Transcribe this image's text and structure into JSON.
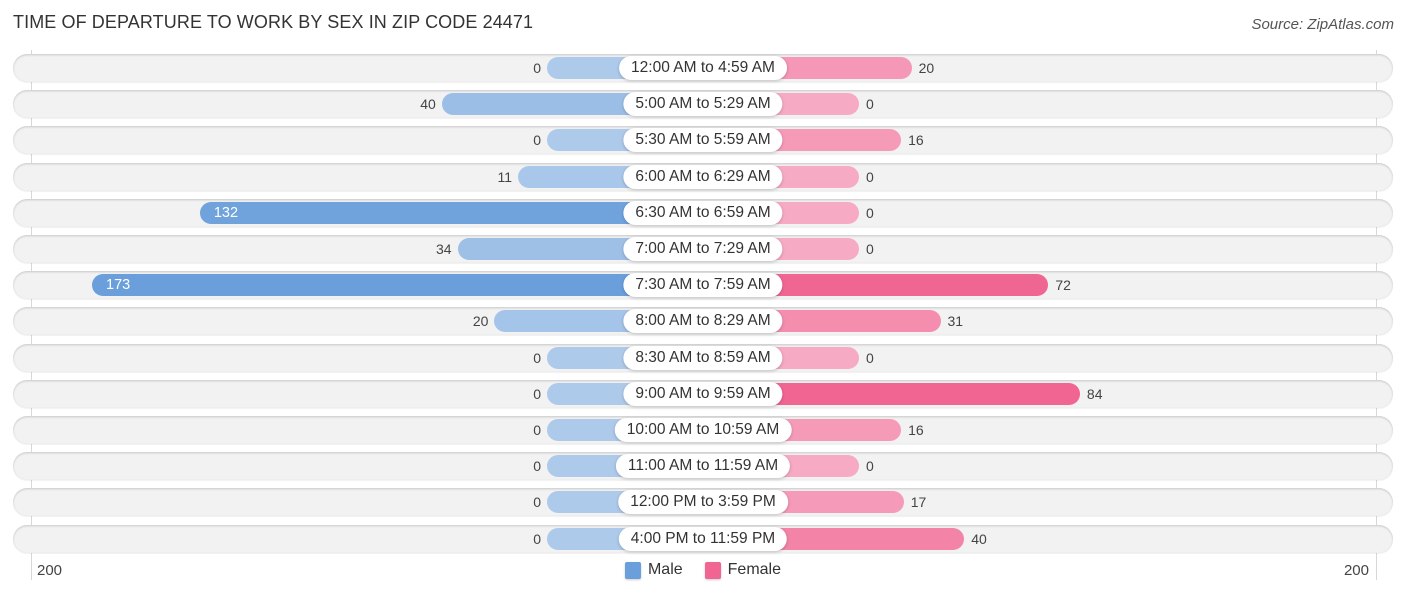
{
  "chart_data": {
    "type": "bar",
    "orientation": "horizontal-diverging",
    "title": "TIME OF DEPARTURE TO WORK BY SEX IN ZIP CODE 24471",
    "source": "Source: ZipAtlas.com",
    "categories": [
      "12:00 AM to 4:59 AM",
      "5:00 AM to 5:29 AM",
      "5:30 AM to 5:59 AM",
      "6:00 AM to 6:29 AM",
      "6:30 AM to 6:59 AM",
      "7:00 AM to 7:29 AM",
      "7:30 AM to 7:59 AM",
      "8:00 AM to 8:29 AM",
      "8:30 AM to 8:59 AM",
      "9:00 AM to 9:59 AM",
      "10:00 AM to 10:59 AM",
      "11:00 AM to 11:59 AM",
      "12:00 PM to 3:59 PM",
      "4:00 PM to 11:59 PM"
    ],
    "series": [
      {
        "name": "Male",
        "color": "#6a9fdb",
        "values": [
          0,
          40,
          0,
          11,
          132,
          34,
          173,
          20,
          0,
          0,
          0,
          0,
          0,
          0
        ]
      },
      {
        "name": "Female",
        "color": "#f06592",
        "values": [
          20,
          0,
          16,
          0,
          0,
          0,
          72,
          31,
          0,
          84,
          16,
          0,
          17,
          40
        ]
      }
    ],
    "axis": {
      "left_tick": "200",
      "right_tick": "200",
      "max": 200
    },
    "legend": {
      "position": "bottom-center",
      "items": [
        "Male",
        "Female"
      ]
    },
    "grid": false
  }
}
